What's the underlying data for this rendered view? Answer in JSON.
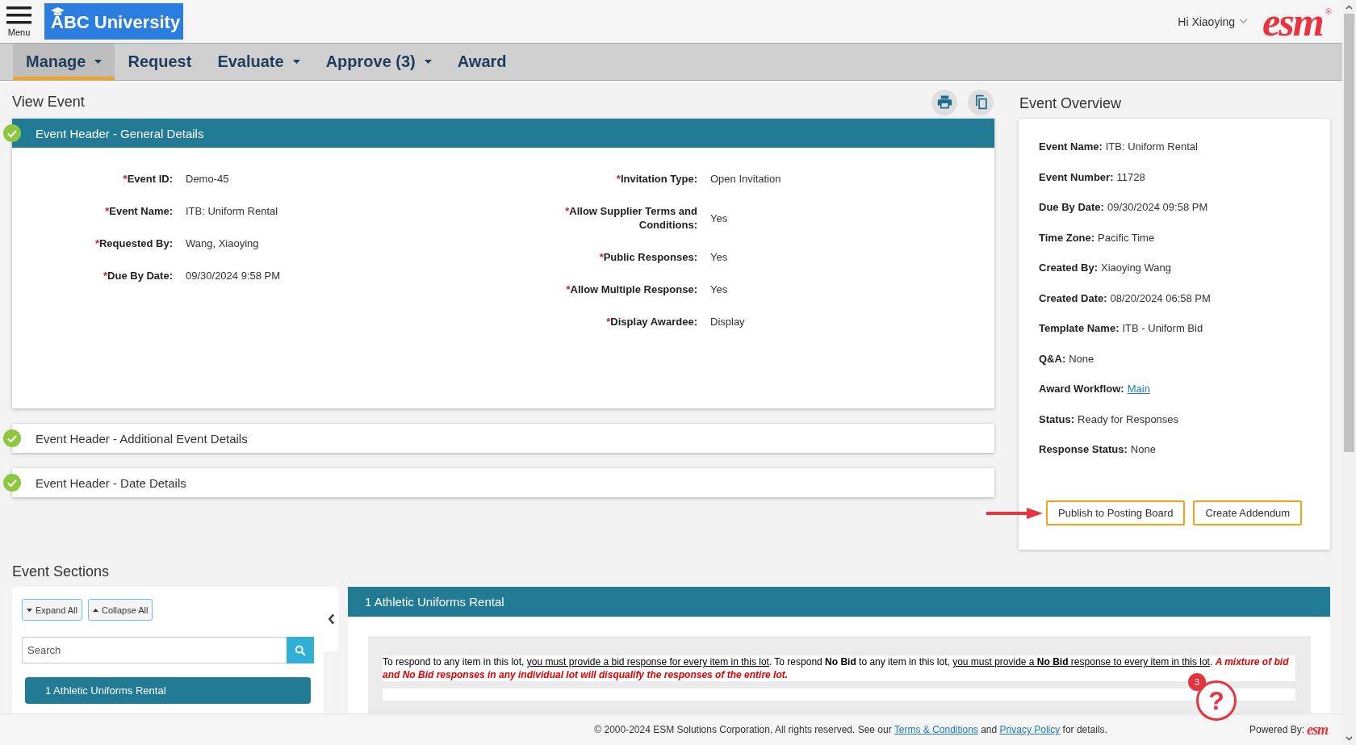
{
  "top_bar": {
    "menu_label": "Menu",
    "logo_text": "ABC University",
    "greeting": "Hi Xiaoying",
    "brand": "esm",
    "brand_mark": "®"
  },
  "nav": [
    {
      "label": "Manage",
      "selected": true,
      "dropdown": true
    },
    {
      "label": "Request",
      "selected": false,
      "dropdown": false
    },
    {
      "label": "Evaluate",
      "selected": false,
      "dropdown": true
    },
    {
      "label": "Approve (3)",
      "selected": false,
      "dropdown": true
    },
    {
      "label": "Award",
      "selected": false,
      "dropdown": false
    }
  ],
  "view_event": {
    "title": "View Event",
    "sections": [
      {
        "title": "Event Header - General Details",
        "expanded": true,
        "complete": true,
        "fields_left": [
          {
            "marker": "*",
            "label": "Event ID:",
            "value": "Demo-45"
          },
          {
            "marker": "*",
            "label": "Event Name:",
            "value": "ITB: Uniform Rental"
          },
          {
            "marker": "*",
            "label": "Requested By:",
            "value": "Wang, Xiaoying"
          },
          {
            "marker": "*",
            "label": "Due By Date:",
            "value": "09/30/2024 9:58 PM"
          }
        ],
        "fields_right": [
          {
            "marker": "*",
            "label": "Invitation Type:",
            "value": "Open Invitation"
          },
          {
            "marker": "*",
            "label": "Allow Supplier Terms and Conditions:",
            "value": "Yes"
          },
          {
            "marker": "*",
            "label": "Public Responses:",
            "value": "Yes"
          },
          {
            "marker": "*",
            "label": "Allow Multiple Response:",
            "value": "Yes"
          },
          {
            "marker": "*",
            "label": "Display Awardee:",
            "value": "Display"
          }
        ]
      },
      {
        "title": "Event Header - Additional Event Details",
        "expanded": false,
        "complete": true
      },
      {
        "title": "Event Header - Date Details",
        "expanded": false,
        "complete": true
      }
    ]
  },
  "event_overview": {
    "title": "Event Overview",
    "rows": [
      {
        "label": "Event Name:",
        "value": "ITB: Uniform Rental",
        "kind": "text"
      },
      {
        "label": "Event Number:",
        "value": "11728",
        "kind": "text"
      },
      {
        "label": "Due By Date:",
        "value": "09/30/2024 09:58 PM",
        "kind": "text"
      },
      {
        "label": "Time Zone:",
        "value": "Pacific Time",
        "kind": "text"
      },
      {
        "label": "Created By:",
        "value": "Xiaoying Wang",
        "kind": "text"
      },
      {
        "label": "Created Date:",
        "value": "08/20/2024 06:58 PM",
        "kind": "text"
      },
      {
        "label": "Template Name:",
        "value": "ITB - Uniform Bid",
        "kind": "text"
      },
      {
        "label": "Q&A:",
        "value": "None",
        "kind": "text"
      },
      {
        "label": "Award Workflow:",
        "value": "Main",
        "kind": "link"
      },
      {
        "label": "Status:",
        "value": "Ready for Responses",
        "kind": "text"
      },
      {
        "label": "Response Status:",
        "value": "None",
        "kind": "text"
      }
    ],
    "buttons": [
      "Publish to Posting Board",
      "Create Addendum"
    ]
  },
  "event_sections": {
    "title": "Event Sections",
    "buttons": [
      {
        "label": "Expand All",
        "kind": "expand"
      },
      {
        "label": "Collapse All",
        "kind": "collapse"
      }
    ],
    "search": {
      "placeholder": "Search"
    },
    "items": [
      {
        "label": "1 Athletic Uniforms Rental",
        "selected": true
      }
    ]
  },
  "lot": {
    "title": "1 Athletic Uniforms Rental",
    "instructions": [
      {
        "text": "To respond to any item in this lot, ",
        "kind": "plain"
      },
      {
        "text": "you must provide a bid response for every item in this lot",
        "kind": "underline"
      },
      {
        "text": ". To respond **No Bid** to any item in this lot, ",
        "kind": "plain"
      },
      {
        "text": "you must provide a **No Bid** response to every item in this lot",
        "kind": "underline"
      },
      {
        "text": ". ",
        "kind": "plain"
      },
      {
        "text": "A mixture of bid and No Bid responses in any individual lot will disqualify the responses of the entire lot.",
        "kind": "warning"
      }
    ]
  },
  "help": {
    "badge": "3",
    "glyph": "?"
  },
  "footer": {
    "notice": [
      {
        "text": "© 2000-2024 ESM Solutions Corporation, All rights reserved. See our ",
        "kind": "text"
      },
      {
        "text": "Terms & Conditions",
        "kind": "link"
      },
      {
        "text": " and ",
        "kind": "text"
      },
      {
        "text": "Privacy Policy",
        "kind": "link"
      },
      {
        "text": " for details.",
        "kind": "text"
      }
    ],
    "powered_by": "Powered By:",
    "brand": "esm"
  }
}
